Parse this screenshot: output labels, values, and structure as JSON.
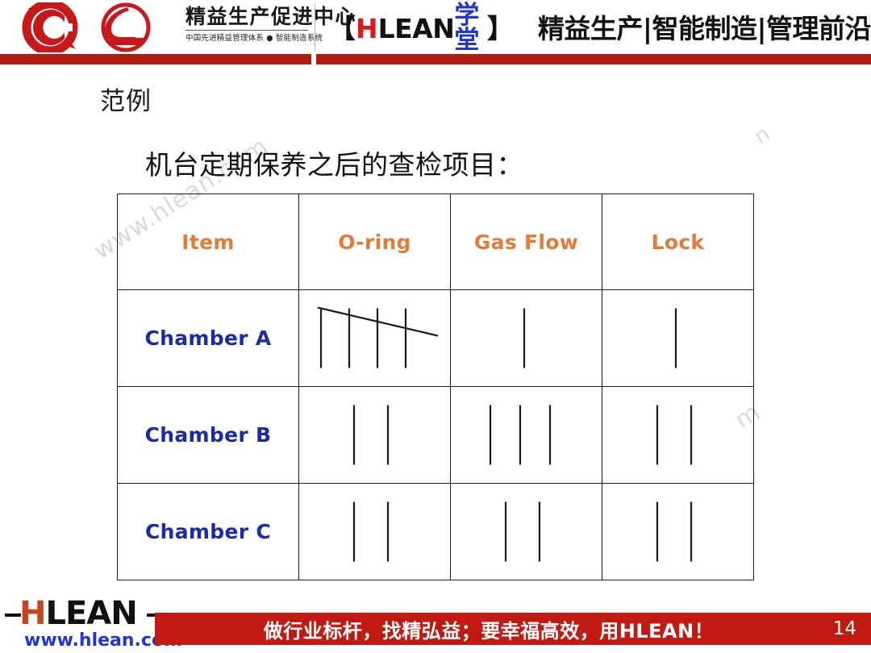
{
  "header": {
    "logo": {
      "title": "精益生产促进中心",
      "subtitle": "中国先进精益管理体系 ● 智能制造系统",
      "mark_color": "#C8181C"
    },
    "brand": {
      "bracket_open": "【",
      "h": "H",
      "lean": "LEAN",
      "xuetang": "学堂",
      "bracket_close": "】",
      "h_color": "#E3151B",
      "xuetang_color": "#2134D8"
    },
    "tagline": "精益生产|智能制造|管理前沿",
    "bar_color": "#B21B12"
  },
  "slide": {
    "title": "范例",
    "subtitle": "机台定期保养之后的查检项目："
  },
  "table": {
    "header_color": "#E07B39",
    "row_label_color": "#1B2BA8",
    "columns": [
      {
        "key": "item",
        "label": "Item"
      },
      {
        "key": "oring",
        "label": "O-ring"
      },
      {
        "key": "gas_flow",
        "label": "Gas Flow"
      },
      {
        "key": "lock",
        "label": "Lock"
      }
    ],
    "rows": [
      {
        "label": "Chamber A",
        "counts": {
          "oring": 5,
          "gas_flow": 1,
          "lock": 1
        }
      },
      {
        "label": "Chamber B",
        "counts": {
          "oring": 2,
          "gas_flow": 3,
          "lock": 2
        }
      },
      {
        "label": "Chamber C",
        "counts": {
          "oring": 2,
          "gas_flow": 2,
          "lock": 2
        }
      }
    ]
  },
  "watermarks": {
    "text": "www.hlean.com",
    "fragment_right": "m",
    "fragment_top_right": "n"
  },
  "footer": {
    "logo": {
      "h": "H",
      "lean": "LEAN",
      "url": "www.hlean.com",
      "h_color": "#C1471E",
      "url_color": "#2134D8"
    },
    "slogan": "做行业标杆，找精弘益；要幸福高效，用HLEAN！",
    "page_number": "14",
    "bar_color": "#C21A12"
  }
}
